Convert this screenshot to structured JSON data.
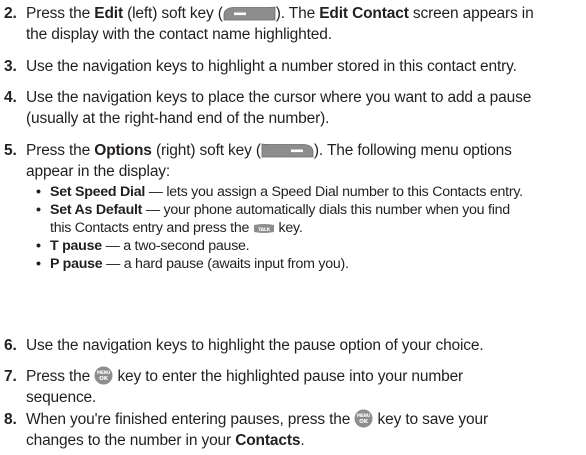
{
  "steps": [
    {
      "n": "2.",
      "parts": [
        "Press the ",
        "Edit",
        " (left) soft key (",
        "). The ",
        "Edit Contact",
        " screen appears in",
        "the display with the contact name highlighted."
      ]
    },
    {
      "n": "3.",
      "text": "Use the navigation keys to highlight a number stored in this contact entry."
    },
    {
      "n": "4.",
      "line1": "Use the navigation keys to place the cursor where you want to add a pause",
      "line2": "(usually at the right-hand end of the number)."
    },
    {
      "n": "5.",
      "parts": [
        "Press the ",
        "Options",
        " (right) soft key (",
        "). The following menu options",
        "appear in the display:"
      ]
    },
    {
      "n": "6.",
      "text": "Use the navigation keys to highlight the pause option of your choice."
    },
    {
      "n": "7.",
      "parts": [
        "Press the ",
        " key to enter the highlighted pause into your number",
        "sequence."
      ]
    },
    {
      "n": "8.",
      "parts": [
        "When you're finished entering pauses, press the ",
        " key to save your",
        "changes to the number in your ",
        "Contacts",
        "."
      ]
    }
  ],
  "bullets": [
    {
      "term": "Set Speed Dial",
      "desc": " — lets you assign a Speed Dial number to this Contacts entry."
    },
    {
      "term": "Set As Default",
      "desc": " — your phone automatically dials this number when you find",
      "desc2": "this Contacts entry and press the ",
      "desc3": " key."
    },
    {
      "term": "T pause",
      "desc": " — a two-second pause."
    },
    {
      "term": "P pause",
      "desc": " — a hard pause (awaits input from you)."
    }
  ],
  "icons": {
    "left_soft_key": "left-soft-key-icon",
    "right_soft_key": "right-soft-key-icon",
    "talk_key": "talk-key-icon",
    "menu_ok_key": "menu-ok-key-icon",
    "talk_label": "TALK",
    "menu_label": "MENU",
    "ok_label": "OK"
  },
  "colors": {
    "text": "#231f20",
    "key_gray": "#8a8a8a"
  }
}
